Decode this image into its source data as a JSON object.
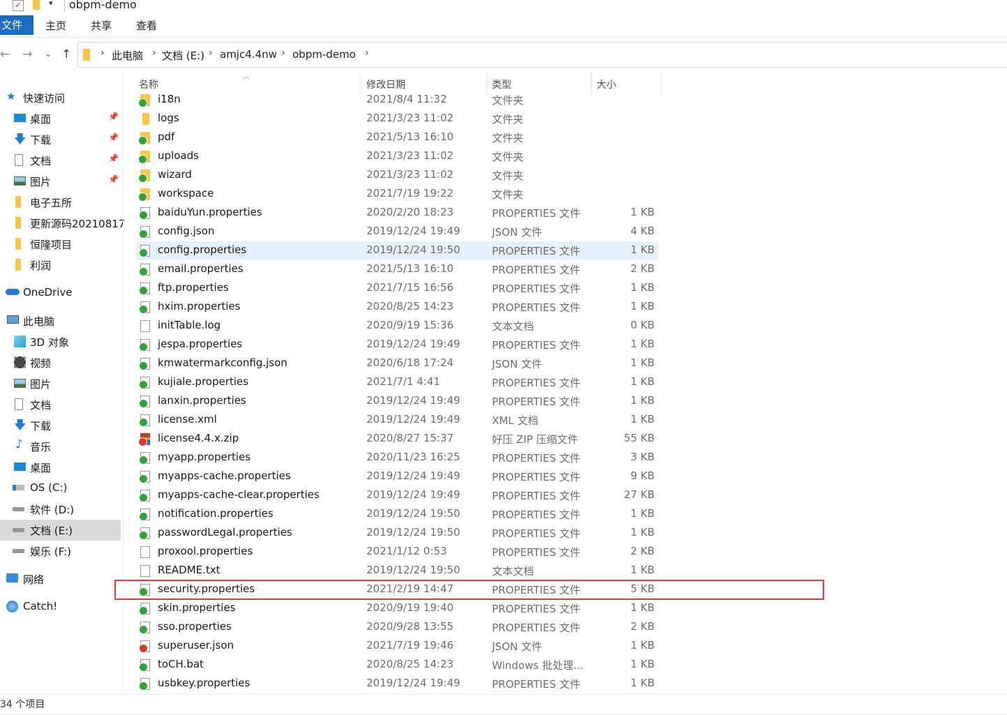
{
  "window": {
    "title": "obpm-demo"
  },
  "ribbon": {
    "file": "文件",
    "tabs": [
      "主页",
      "共享",
      "查看"
    ]
  },
  "address": {
    "crumbs": [
      "此电脑",
      "文档 (E:)",
      "amjc4.4nw",
      "obpm-demo"
    ]
  },
  "sidebar": {
    "quick_access": "快速访问",
    "quick_items": [
      "桌面",
      "下载",
      "文档",
      "图片",
      "电子五所",
      "更新源码20210817",
      "恒隆项目",
      "利润"
    ],
    "onedrive": "OneDrive",
    "this_pc": "此电脑",
    "pc_items": [
      "3D 对象",
      "视频",
      "图片",
      "文档",
      "下载",
      "音乐",
      "桌面",
      "OS (C:)",
      "软件 (D:)",
      "文档 (E:)",
      "娱乐 (F:)"
    ],
    "network": "网络",
    "catch": "Catch!"
  },
  "columns": {
    "name": "名称",
    "date": "修改日期",
    "type": "类型",
    "size": "大小"
  },
  "files": [
    {
      "name": "i18n",
      "date": "2021/8/4 11:32",
      "type": "文件夹",
      "size": "",
      "icon": "folder-synced"
    },
    {
      "name": "logs",
      "date": "2021/3/23 11:02",
      "type": "文件夹",
      "size": "",
      "icon": "folder"
    },
    {
      "name": "pdf",
      "date": "2021/5/13 16:10",
      "type": "文件夹",
      "size": "",
      "icon": "folder-synced"
    },
    {
      "name": "uploads",
      "date": "2021/3/23 11:02",
      "type": "文件夹",
      "size": "",
      "icon": "folder-synced"
    },
    {
      "name": "wizard",
      "date": "2021/3/23 11:02",
      "type": "文件夹",
      "size": "",
      "icon": "folder-synced"
    },
    {
      "name": "workspace",
      "date": "2021/7/19 19:22",
      "type": "文件夹",
      "size": "",
      "icon": "folder-synced"
    },
    {
      "name": "baiduYun.properties",
      "date": "2020/2/20 18:23",
      "type": "PROPERTIES 文件",
      "size": "1 KB",
      "icon": "file-synced"
    },
    {
      "name": "config.json",
      "date": "2019/12/24 19:49",
      "type": "JSON 文件",
      "size": "4 KB",
      "icon": "file-synced"
    },
    {
      "name": "config.properties",
      "date": "2019/12/24 19:50",
      "type": "PROPERTIES 文件",
      "size": "1 KB",
      "icon": "file-synced"
    },
    {
      "name": "email.properties",
      "date": "2021/5/13 16:10",
      "type": "PROPERTIES 文件",
      "size": "2 KB",
      "icon": "file-synced"
    },
    {
      "name": "ftp.properties",
      "date": "2021/7/15 16:56",
      "type": "PROPERTIES 文件",
      "size": "1 KB",
      "icon": "file-synced"
    },
    {
      "name": "hxim.properties",
      "date": "2020/8/25 14:23",
      "type": "PROPERTIES 文件",
      "size": "1 KB",
      "icon": "file-synced"
    },
    {
      "name": "initTable.log",
      "date": "2020/9/19 15:36",
      "type": "文本文档",
      "size": "0 KB",
      "icon": "text"
    },
    {
      "name": "jespa.properties",
      "date": "2019/12/24 19:49",
      "type": "PROPERTIES 文件",
      "size": "1 KB",
      "icon": "file-synced"
    },
    {
      "name": "kmwatermarkconfig.json",
      "date": "2020/6/18 17:24",
      "type": "JSON 文件",
      "size": "1 KB",
      "icon": "file-synced"
    },
    {
      "name": "kujiale.properties",
      "date": "2021/7/1 4:41",
      "type": "PROPERTIES 文件",
      "size": "1 KB",
      "icon": "file-synced"
    },
    {
      "name": "lanxin.properties",
      "date": "2019/12/24 19:49",
      "type": "PROPERTIES 文件",
      "size": "1 KB",
      "icon": "file-synced"
    },
    {
      "name": "license.xml",
      "date": "2019/12/24 19:49",
      "type": "XML 文档",
      "size": "1 KB",
      "icon": "file-synced"
    },
    {
      "name": "license4.4.x.zip",
      "date": "2020/8/27 15:37",
      "type": "好压 ZIP 压缩文件",
      "size": "55 KB",
      "icon": "zip"
    },
    {
      "name": "myapp.properties",
      "date": "2020/11/23 16:25",
      "type": "PROPERTIES 文件",
      "size": "3 KB",
      "icon": "file-synced"
    },
    {
      "name": "myapps-cache.properties",
      "date": "2019/12/24 19:49",
      "type": "PROPERTIES 文件",
      "size": "9 KB",
      "icon": "file-synced"
    },
    {
      "name": "myapps-cache-clear.properties",
      "date": "2019/12/24 19:49",
      "type": "PROPERTIES 文件",
      "size": "27 KB",
      "icon": "file-synced"
    },
    {
      "name": "notification.properties",
      "date": "2019/12/24 19:50",
      "type": "PROPERTIES 文件",
      "size": "1 KB",
      "icon": "file-synced"
    },
    {
      "name": "passwordLegal.properties",
      "date": "2019/12/24 19:50",
      "type": "PROPERTIES 文件",
      "size": "1 KB",
      "icon": "file-synced"
    },
    {
      "name": "proxool.properties",
      "date": "2021/1/12 0:53",
      "type": "PROPERTIES 文件",
      "size": "2 KB",
      "icon": "file"
    },
    {
      "name": "README.txt",
      "date": "2019/12/24 19:50",
      "type": "文本文档",
      "size": "1 KB",
      "icon": "text"
    },
    {
      "name": "security.properties",
      "date": "2021/2/19 14:47",
      "type": "PROPERTIES 文件",
      "size": "5 KB",
      "icon": "file-synced"
    },
    {
      "name": "skin.properties",
      "date": "2020/9/19 19:40",
      "type": "PROPERTIES 文件",
      "size": "1 KB",
      "icon": "file-synced"
    },
    {
      "name": "sso.properties",
      "date": "2020/9/28 13:55",
      "type": "PROPERTIES 文件",
      "size": "2 KB",
      "icon": "file-synced"
    },
    {
      "name": "superuser.json",
      "date": "2021/7/19 19:46",
      "type": "JSON 文件",
      "size": "1 KB",
      "icon": "file-error"
    },
    {
      "name": "toCH.bat",
      "date": "2020/8/25 14:23",
      "type": "Windows 批处理...",
      "size": "1 KB",
      "icon": "file-synced"
    },
    {
      "name": "usbkey.properties",
      "date": "2019/12/24 19:49",
      "type": "PROPERTIES 文件",
      "size": "1 KB",
      "icon": "file-synced"
    }
  ],
  "status": {
    "count_text": "34 个项目"
  },
  "colors": {
    "accent": "#1c6cc1",
    "highlight": "#e5f1fb",
    "selection_box": "#e23b3b",
    "sync_ok": "#2fa33a"
  }
}
